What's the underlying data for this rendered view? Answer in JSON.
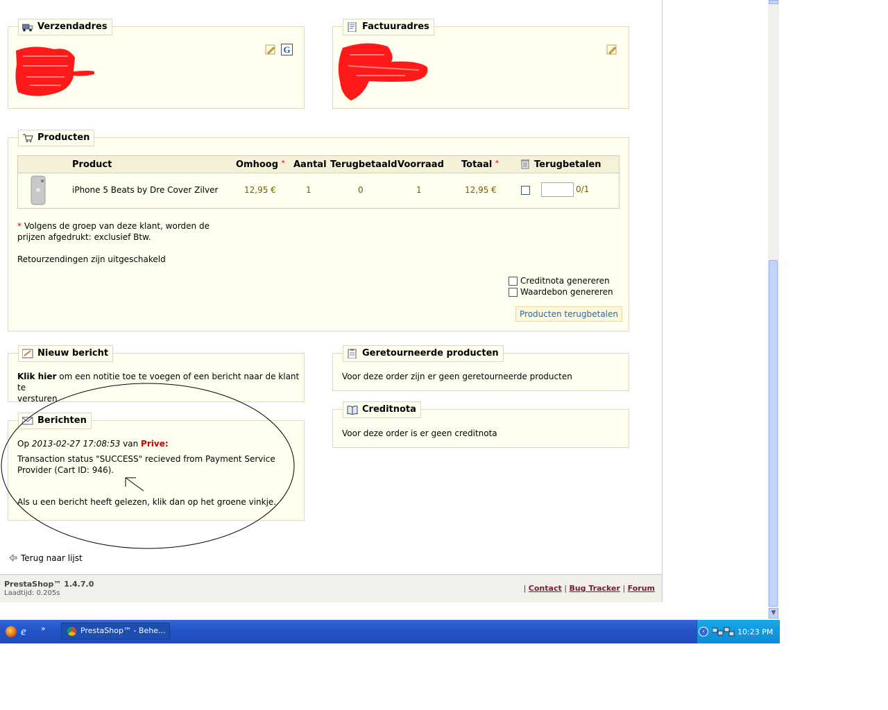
{
  "shipping": {
    "title": "Verzendadres"
  },
  "billing": {
    "title": "Factuuradres"
  },
  "products": {
    "title": "Producten",
    "headers": {
      "product": "Product",
      "omhoog": "Omhoog",
      "aantal": "Aantal",
      "terugbetaald": "Terugbetaald",
      "voorraad": "Voorraad",
      "totaal": "Totaal",
      "terugbetalen": "Terugbetalen"
    },
    "rows": [
      {
        "name": "iPhone 5 Beats by Dre Cover Zilver",
        "price": "12,95 €",
        "qty": "1",
        "refunded": "0",
        "stock": "1",
        "total": "12,95 €",
        "refund_value": "",
        "refund_max": "0/1"
      }
    ],
    "note_line1": "Volgens de groep van deze klant, worden de",
    "note_line2": "prijzen afgedrukt: exclusief Btw.",
    "returns_disabled": "Retourzendingen zijn uitgeschakeld",
    "credit_label": "Creditnota genereren",
    "voucher_label": "Waardebon genereren",
    "refund_button": "Producten terugbetalen"
  },
  "new_message": {
    "title": "Nieuw bericht",
    "link": "Klik hier",
    "text1": " om een notitie toe te voegen of een bericht naar de klant te",
    "text2": "versturen"
  },
  "messages": {
    "title": "Berichten",
    "prefix": "Op ",
    "date": "2013-02-27 17:08:53",
    "van": " van ",
    "author": "Prive:",
    "body1": "Transaction status \"SUCCESS\" recieved from Payment Service",
    "body2": "Provider (Cart ID: 946).",
    "read_hint": "Als u een bericht heeft gelezen, klik dan op het groene vinkje."
  },
  "returned": {
    "title": "Geretourneerde producten",
    "text": "Voor deze order zijn er geen geretourneerde producten"
  },
  "creditnota": {
    "title": "Creditnota",
    "text": "Voor deze order is er geen creditnota"
  },
  "back_link": "Terug naar lijst",
  "footer": {
    "brand": "PrestaShop™ 1.4.7.0",
    "load": "Laadtijd: 0.205s",
    "contact": "Contact",
    "bugtracker": "Bug Tracker",
    "forum": "Forum",
    "sep": "|"
  },
  "taskbar": {
    "window": "PrestaShop™ - Behe...",
    "time": "10:23 PM"
  }
}
